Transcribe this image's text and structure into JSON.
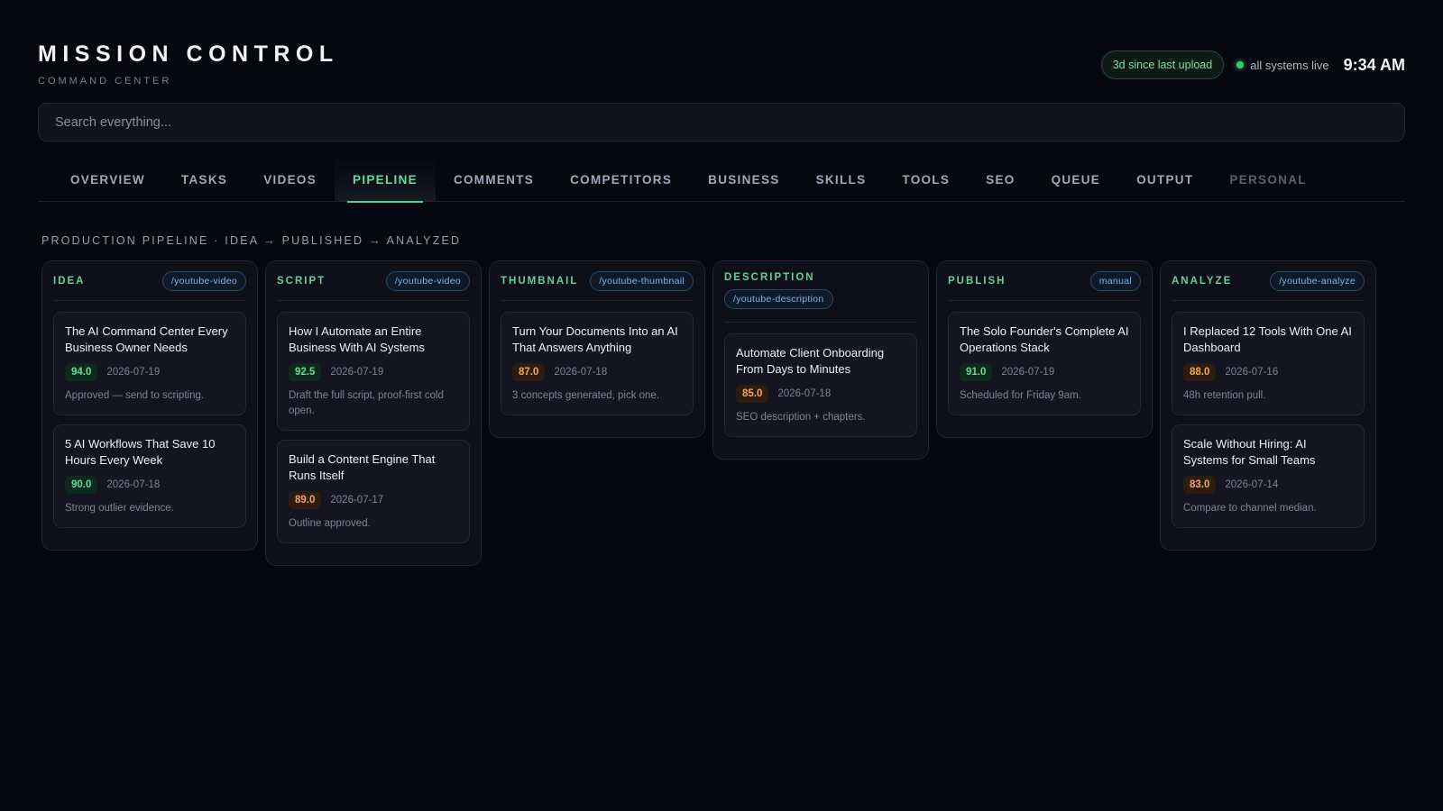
{
  "header": {
    "title": "MISSION CONTROL",
    "subtitle": "COMMAND CENTER",
    "upload_status": "3d since last upload",
    "system_status": "all systems live",
    "time": "9:34 AM",
    "colors": {
      "accent": "#5fd495",
      "live_dot": "#36c96f",
      "background": "#07070f"
    }
  },
  "search": {
    "placeholder": "Search everything..."
  },
  "tabs": [
    {
      "label": "OVERVIEW"
    },
    {
      "label": "TASKS"
    },
    {
      "label": "VIDEOS"
    },
    {
      "label": "PIPELINE",
      "active": true
    },
    {
      "label": "COMMENTS"
    },
    {
      "label": "COMPETITORS"
    },
    {
      "label": "BUSINESS"
    },
    {
      "label": "SKILLS"
    },
    {
      "label": "TOOLS"
    },
    {
      "label": "SEO"
    },
    {
      "label": "QUEUE"
    },
    {
      "label": "OUTPUT"
    },
    {
      "label": "PERSONAL"
    }
  ],
  "section_label": "PRODUCTION PIPELINE · IDEA → PUBLISHED → ANALYZED",
  "columns": [
    {
      "title": "IDEA",
      "tag": "/youtube-video",
      "cards": [
        {
          "title": "The AI Command Center Every Business Owner Needs",
          "score": "94.0",
          "score_color": "green",
          "date": "2026-07-19",
          "note": "Approved — send to scripting."
        },
        {
          "title": "5 AI Workflows That Save 10 Hours Every Week",
          "score": "90.0",
          "score_color": "green",
          "date": "2026-07-18",
          "note": "Strong outlier evidence."
        }
      ]
    },
    {
      "title": "SCRIPT",
      "tag": "/youtube-video",
      "cards": [
        {
          "title": "How I Automate an Entire Business With AI Systems",
          "score": "92.5",
          "score_color": "green",
          "date": "2026-07-19",
          "note": "Draft the full script, proof-first cold open."
        },
        {
          "title": "Build a Content Engine That Runs Itself",
          "score": "89.0",
          "score_color": "orange",
          "date": "2026-07-17",
          "note": "Outline approved."
        }
      ]
    },
    {
      "title": "THUMBNAIL",
      "tag": "/youtube-thumbnail",
      "cards": [
        {
          "title": "Turn Your Documents Into an AI That Answers Anything",
          "score": "87.0",
          "score_color": "orange",
          "date": "2026-07-18",
          "note": "3 concepts generated, pick one."
        }
      ]
    },
    {
      "title": "DESCRIPTION",
      "tag": "/youtube-description",
      "cards": [
        {
          "title": "Automate Client Onboarding From Days to Minutes",
          "score": "85.0",
          "score_color": "orange",
          "date": "2026-07-18",
          "note": "SEO description + chapters."
        }
      ]
    },
    {
      "title": "PUBLISH",
      "tag": "manual",
      "cards": [
        {
          "title": "The Solo Founder's Complete AI Operations Stack",
          "score": "91.0",
          "score_color": "green",
          "date": "2026-07-19",
          "note": "Scheduled for Friday 9am."
        }
      ]
    },
    {
      "title": "ANALYZE",
      "tag": "/youtube-analyze",
      "cards": [
        {
          "title": "I Replaced 12 Tools With One AI Dashboard",
          "score": "88.0",
          "score_color": "orange",
          "date": "2026-07-16",
          "note": "48h retention pull."
        },
        {
          "title": "Scale Without Hiring: AI Systems for Small Teams",
          "score": "83.0",
          "score_color": "orange",
          "date": "2026-07-14",
          "note": "Compare to channel median."
        }
      ]
    }
  ]
}
